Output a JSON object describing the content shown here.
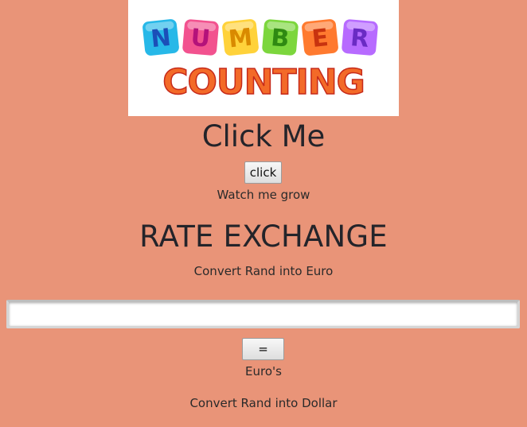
{
  "logo": {
    "word1": "NUMBER",
    "word2": "COUNTING",
    "block_colors": [
      "#27b8e8",
      "#f2528f",
      "#ffd23a",
      "#7cd63d",
      "#ff7a2f",
      "#b76bff"
    ],
    "letter_colors": [
      "#1b4fb8",
      "#b4127a",
      "#d98a00",
      "#2f8a12",
      "#c8330f",
      "#6a2bc4"
    ]
  },
  "click_section": {
    "heading": "Click Me",
    "button_label": "click",
    "grow_text": "Watch me grow"
  },
  "exchange": {
    "heading": "RATE EXCHANGE",
    "euro_label": "Convert Rand into Euro",
    "input_value": "",
    "equals_label": "=",
    "euro_result": "Euro's",
    "dollar_label": "Convert Rand into Dollar"
  },
  "colors": {
    "page_background": "#e99478"
  }
}
